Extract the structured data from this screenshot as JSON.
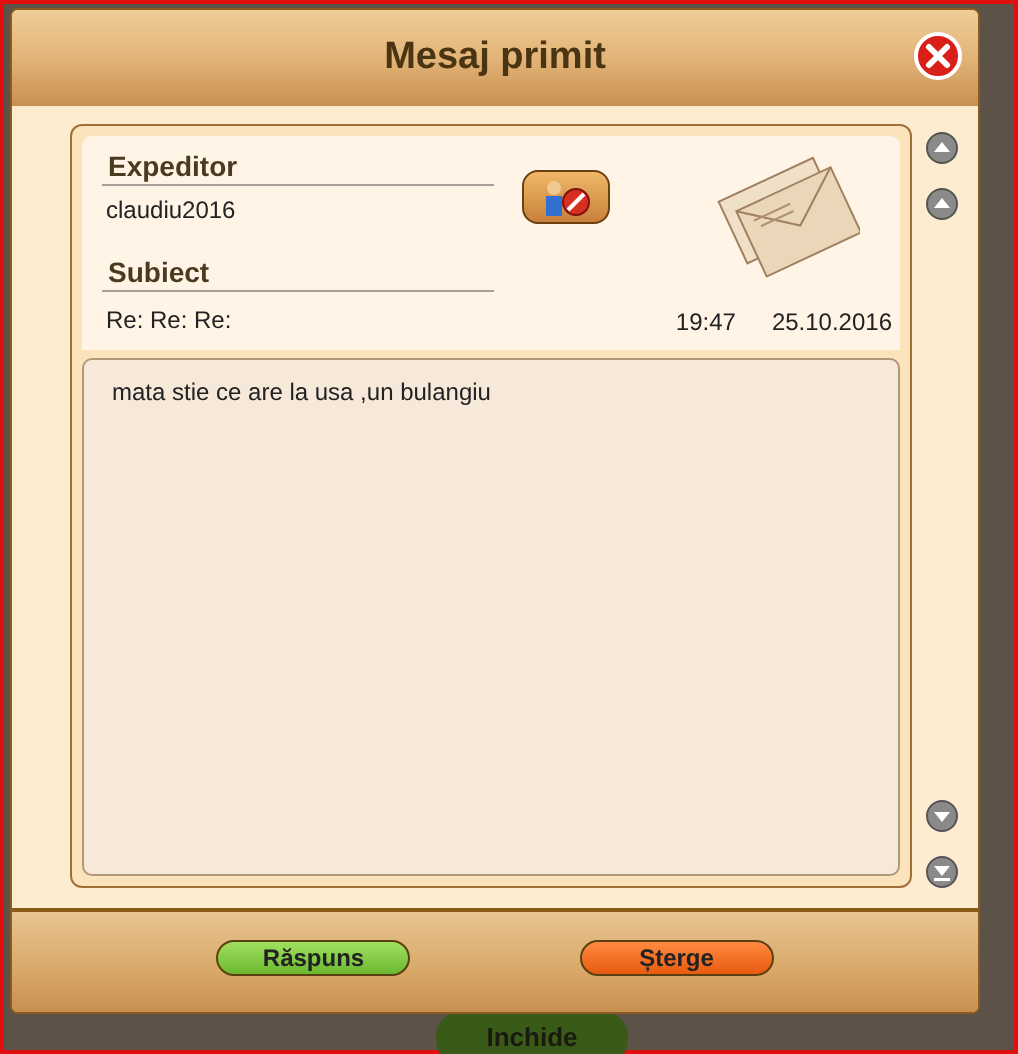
{
  "window": {
    "title": "Mesaj primit"
  },
  "sender": {
    "label": "Expeditor",
    "value": "claudiu2016"
  },
  "subject": {
    "label": "Subiect",
    "value": "Re: Re: Re:"
  },
  "time": "19:47",
  "date": "25.10.2016",
  "body": "mata stie ce are la usa ,un bulangiu",
  "buttons": [
    {
      "label": "Răspuns",
      "kind": "reply"
    },
    {
      "label": "Șterge",
      "kind": "delete"
    }
  ],
  "background_button": {
    "label": "Inchide"
  }
}
